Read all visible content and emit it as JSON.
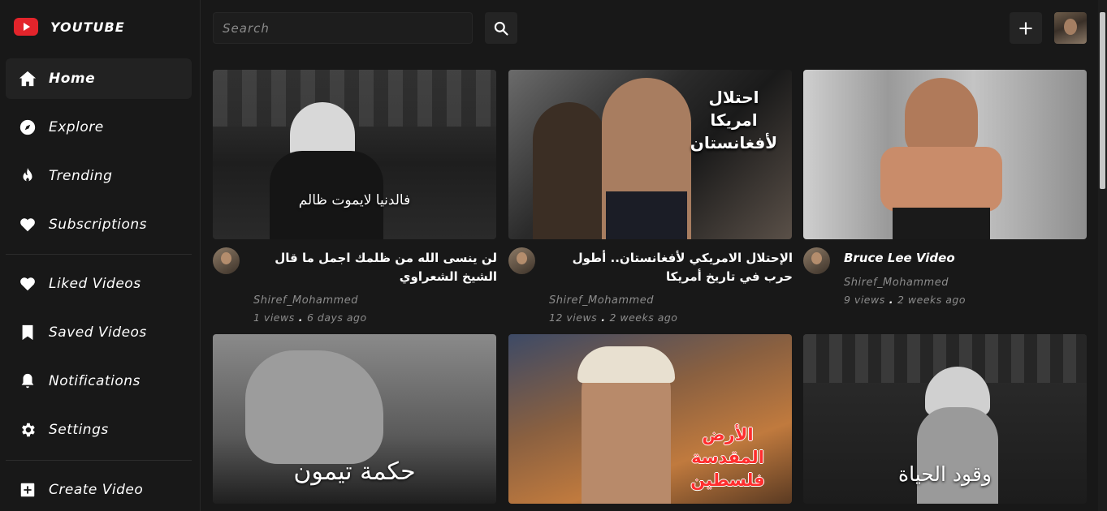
{
  "app": {
    "title": "YOUTUBE"
  },
  "sidebar": {
    "items": [
      {
        "label": "Home",
        "icon": "home-icon"
      },
      {
        "label": "Explore",
        "icon": "compass-icon"
      },
      {
        "label": "Trending",
        "icon": "flame-icon"
      },
      {
        "label": "Subscriptions",
        "icon": "heart-icon"
      },
      {
        "label": "Liked Videos",
        "icon": "heart-icon"
      },
      {
        "label": "Saved Videos",
        "icon": "bookmark-icon"
      },
      {
        "label": "Notifications",
        "icon": "bell-icon"
      },
      {
        "label": "Settings",
        "icon": "gear-icon"
      },
      {
        "label": "Create Video",
        "icon": "plus-square-icon"
      }
    ]
  },
  "search": {
    "placeholder": "Search",
    "value": ""
  },
  "colors": {
    "brand": "#e3242b",
    "background": "#181818",
    "muted": "#8c8c8c"
  },
  "videos": [
    {
      "title": "لن ينسى الله من ظلمك اجمل ما قال الشيخ الشعراوي",
      "thumb_text": "",
      "channel": "Shiref_Mohammed",
      "views": "1 views",
      "age": "6 days ago"
    },
    {
      "title": "الإحتلال الامريكي لأفغانستان.. أطول حرب في تاريخ أمريكا",
      "thumb_text": "احتلال امريكا لأفغانستان",
      "channel": "Shiref_Mohammed",
      "views": "12 views",
      "age": "2 weeks ago"
    },
    {
      "title": "Bruce Lee Video",
      "thumb_text": "",
      "channel": "Shiref_Mohammed",
      "views": "9 views",
      "age": "2 weeks ago"
    },
    {
      "title": "",
      "thumb_text": "حكمة تيمون",
      "channel": "",
      "views": "",
      "age": ""
    },
    {
      "title": "",
      "thumb_text": "الأرض المقدسة فلسطين",
      "channel": "",
      "views": "",
      "age": ""
    },
    {
      "title": "",
      "thumb_text": "وقود الحياة",
      "channel": "",
      "views": "",
      "age": ""
    }
  ],
  "thumb_captions": {
    "v0": "فالدنيا لايموت ظالم"
  }
}
